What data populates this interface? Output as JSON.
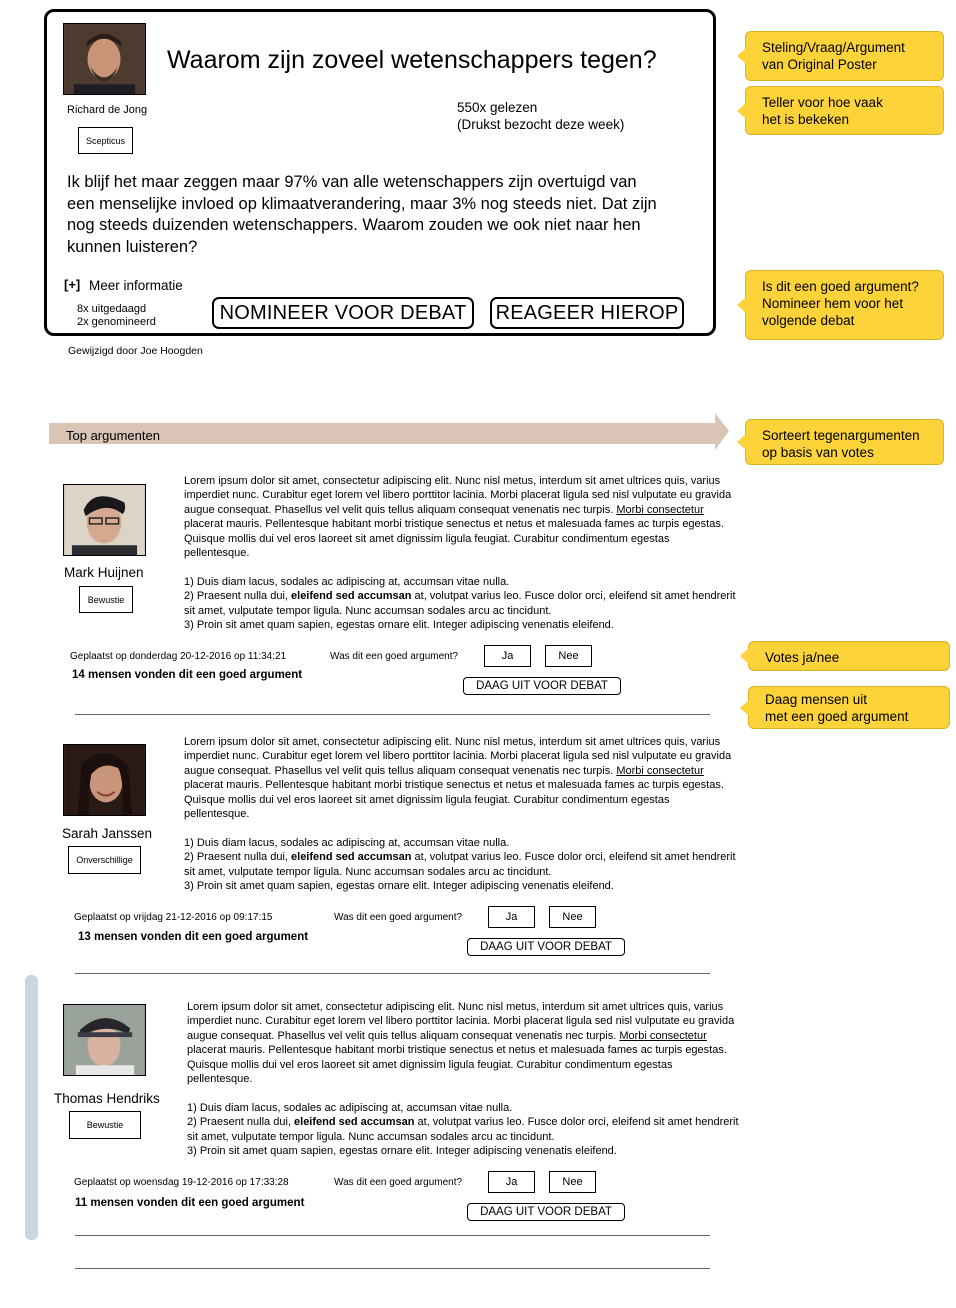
{
  "op": {
    "title": "Waarom zijn zoveel wetenschappers tegen?",
    "author": "Richard de Jong",
    "badge": "Scepticus",
    "views": "550x gelezen",
    "views_note": "(Drukst bezocht deze week)",
    "body": "Ik blijf het maar zeggen maar 97% van alle wetenschappers zijn overtuigd van een menselijke invloed op klimaatverandering, maar 3% nog steeds niet. Dat zijn nog steeds duizenden wetenschappers. Waarom zouden we ook niet naar hen kunnen luisteren?",
    "more_toggle": "[+]",
    "more_label": "Meer informatie",
    "challenged": "8x uitgedaagd",
    "nominated": "2x genomineerd",
    "nominate_button": "NOMINEER VOOR DEBAT",
    "reply_button": "REAGEER HIEROP",
    "edited_by": "Gewijzigd door Joe Hoogden"
  },
  "annotations": {
    "op": [
      "Steling/Vraag/Argument",
      "van Original Poster"
    ],
    "views": [
      "Teller voor hoe vaak",
      "het is bekeken"
    ],
    "nominate": [
      "Is dit een goed argument?",
      "Nomineer hem voor het",
      "volgende debat"
    ],
    "sort": [
      "Sorteert tegenargumenten",
      "op basis van votes"
    ],
    "votes": [
      "Votes ja/nee"
    ],
    "challenge": [
      "Daag mensen uit",
      "met een goed argument"
    ]
  },
  "top_bar": {
    "label": "Top argumenten"
  },
  "argument_text": {
    "p1_a": "Lorem ipsum dolor sit amet, consectetur adipiscing elit. Nunc nisl metus, interdum sit amet ultrices quis, varius imperdiet nunc. Curabitur eget lorem vel libero porttitor lacinia. Morbi placerat ligula sed nisl vulputate eu gravida augue consequat. Phasellus vel velit quis tellus aliquam consequat venenatis nec turpis. ",
    "p1_link": "Morbi consectetur",
    "p1_b": " placerat mauris. Pellentesque habitant morbi tristique senectus et netus et malesuada fames ac turpis egestas. Quisque mollis dui vel eros laoreet sit amet dignissim ligula feugiat. Curabitur condimentum egestas pellentesque.",
    "l1": "1) Duis diam lacus, sodales ac adipiscing at, accumsan vitae nulla.",
    "l2_a": "2) Praesent nulla dui, ",
    "l2_bold": "eleifend sed accumsan",
    "l2_b": " at, volutpat varius leo. Fusce dolor orci, eleifend sit amet hendrerit sit amet, vulputate tempor ligula. Nunc accumsan sodales arcu ac tincidunt.",
    "l3": "3) Proin sit amet quam sapien, egestas ornare elit. Integer adipiscing venenatis eleifend."
  },
  "arguments": [
    {
      "name": "Mark Huijnen",
      "badge": "Bewustie",
      "posted": "Geplaatst op donderdag 20-12-2016 op 11:34:21",
      "question": "Was dit een goed argument?",
      "yes": "Ja",
      "no": "Nee",
      "count": "14 mensen vonden dit een goed argument",
      "challenge": "DAAG UIT VOOR DEBAT"
    },
    {
      "name": "Sarah Janssen",
      "badge": "Onverschillige",
      "posted": "Geplaatst op vrijdag 21-12-2016 op 09:17:15",
      "question": "Was dit een goed argument?",
      "yes": "Ja",
      "no": "Nee",
      "count": "13 mensen vonden dit een goed argument",
      "challenge": "DAAG UIT VOOR DEBAT"
    },
    {
      "name": "Thomas Hendriks",
      "badge": "Bewustie",
      "posted": "Geplaatst op woensdag 19-12-2016 op 17:33:28",
      "question": "Was dit een goed argument?",
      "yes": "Ja",
      "no": "Nee",
      "count": "11 mensen vonden dit een goed argument",
      "challenge": "DAAG UIT VOOR DEBAT"
    }
  ]
}
